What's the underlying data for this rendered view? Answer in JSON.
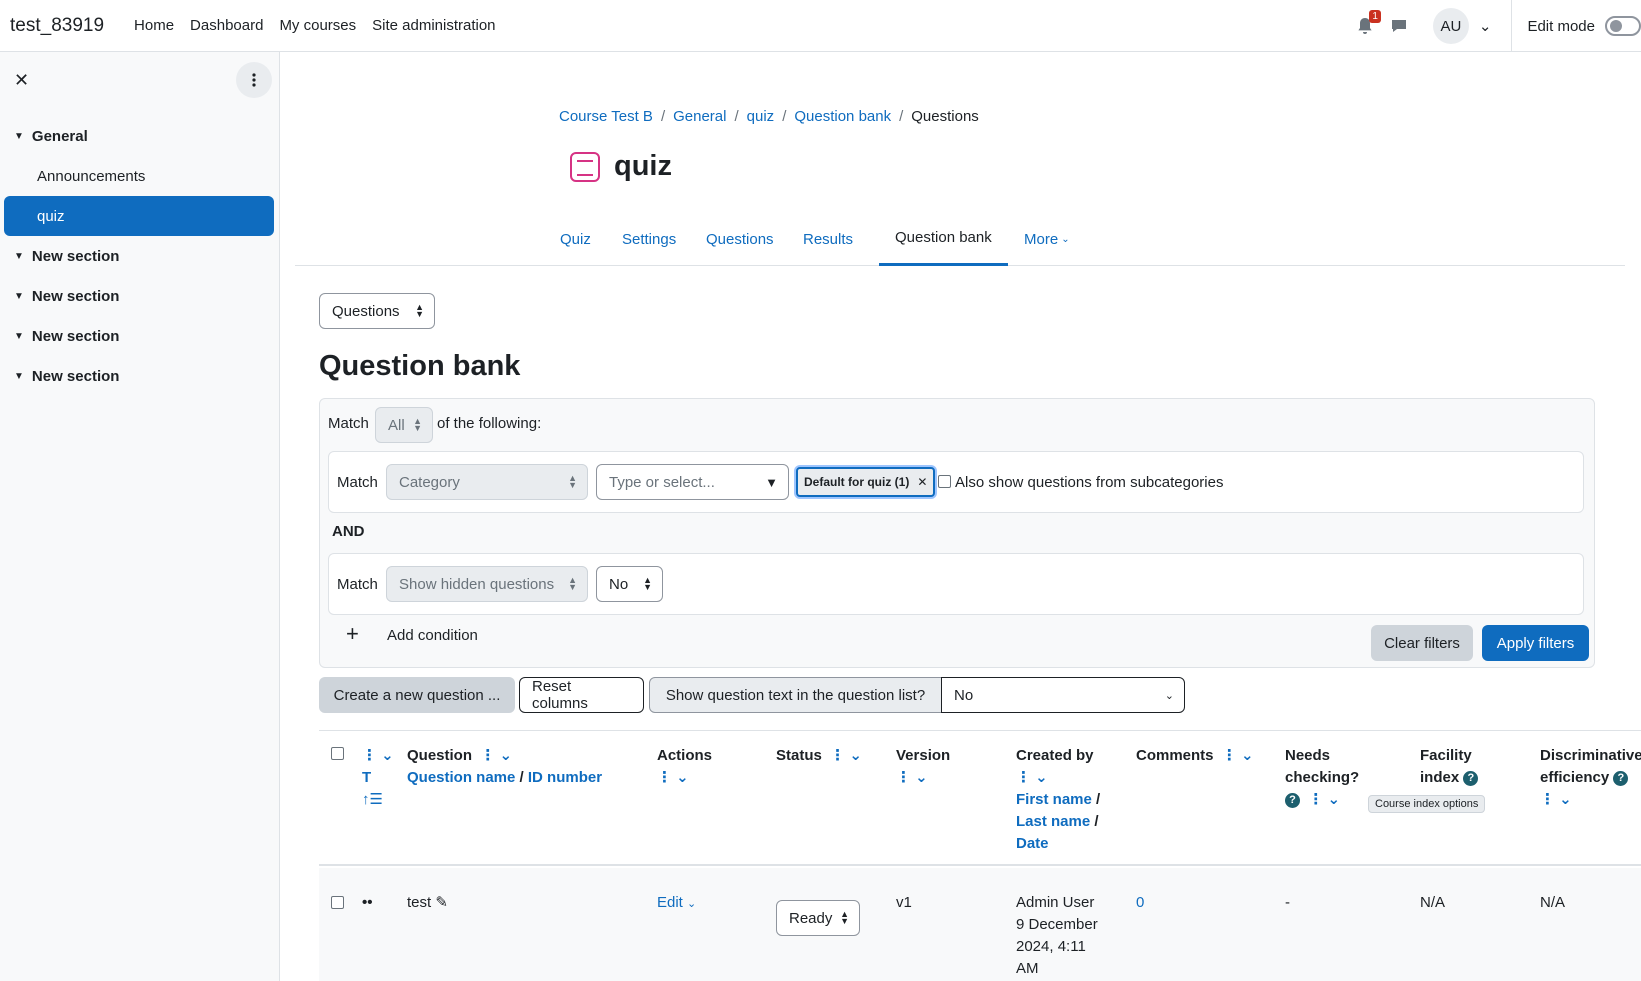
{
  "navbar": {
    "brand": "test_83919",
    "links": [
      "Home",
      "Dashboard",
      "My courses",
      "Site administration"
    ],
    "notification_count": "1",
    "avatar_initials": "AU",
    "edit_mode_label": "Edit mode"
  },
  "drawer": {
    "sections": [
      {
        "title": "General",
        "items": [
          "Announcements",
          "quiz"
        ]
      },
      {
        "title": "New section"
      },
      {
        "title": "New section"
      },
      {
        "title": "New section"
      },
      {
        "title": "New section"
      }
    ],
    "tooltip": "Course index options"
  },
  "breadcrumb": [
    "Course Test B",
    "General",
    "quiz",
    "Question bank",
    "Questions"
  ],
  "page_title": "quiz",
  "tabs": [
    "Quiz",
    "Settings",
    "Questions",
    "Results",
    "Question bank",
    "More"
  ],
  "nav_select": "Questions",
  "question_bank_title": "Question bank",
  "filters": {
    "match_label": "Match",
    "match_value": "All",
    "of_following": "of the following:",
    "row1": {
      "match_label": "Match",
      "field": "Category",
      "type_placeholder": "Type or select...",
      "chip": "Default for quiz (1)",
      "subcat_label": "Also show questions from subcategories"
    },
    "and_label": "AND",
    "row2": {
      "match_label": "Match",
      "field": "Show hidden questions",
      "value": "No"
    },
    "add_condition": "Add condition",
    "clear": "Clear filters",
    "apply": "Apply filters"
  },
  "toolbar": {
    "create": "Create a new question ...",
    "reset": "Reset columns",
    "show_text_label": "Show question text in the question list?",
    "show_text_value": "No"
  },
  "table": {
    "headers": {
      "t_label": "T",
      "question": "Question",
      "question_name": "Question name",
      "id_number": "ID number",
      "actions": "Actions",
      "status": "Status",
      "version": "Version",
      "created_by": "Created by",
      "first_name": "First name",
      "last_name": "Last name",
      "date": "Date",
      "comments": "Comments",
      "needs_checking_1": "Needs",
      "needs_checking_2": "checking?",
      "facility_1": "Facility",
      "facility_2": "index",
      "discrim_1": "Discriminative",
      "discrim_2": "efficiency"
    },
    "row": {
      "name": "test",
      "action": "Edit",
      "status": "Ready",
      "version": "v1",
      "created_by_name": "Admin User",
      "created_date_1": "9 December",
      "created_date_2": "2024, 4:11",
      "created_date_3": "AM",
      "comments": "0",
      "needs_checking": "-",
      "facility": "N/A",
      "discrim": "N/A"
    }
  }
}
